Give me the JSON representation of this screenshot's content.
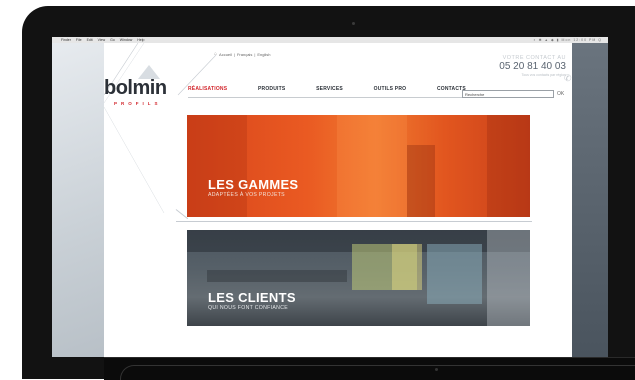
{
  "menubar": {
    "items": [
      "Finder",
      "File",
      "Edit",
      "View",
      "Go",
      "Window",
      "Help"
    ],
    "status": "◐ ✱ ▲ ◆ ▮ Mon 12:00 PM Q"
  },
  "site": {
    "logo_text": "bolmin",
    "logo_subtext": "PROFILS",
    "top_links": {
      "home": "Accueil",
      "sep1": "|",
      "lang_fr": "Français",
      "sep2": "|",
      "lang_en": "English"
    },
    "nav": [
      "RÉALISATIONS",
      "PRODUITS",
      "SERVICES",
      "OUTILS PRO",
      "CONTACTS"
    ],
    "contact": {
      "title": "VOTRE CONTACT AU",
      "phone": "05 20 81 40 03",
      "note": "Tous vos contacts par région"
    },
    "search": {
      "value": "Recherche",
      "button": "OK"
    },
    "banners": [
      {
        "title": "LES GAMMES",
        "subtitle": "ADAPTÉES À VOS PROJETS"
      },
      {
        "title": "LES CLIENTS",
        "subtitle": "QUI NOUS FONT CONFIANCE"
      }
    ]
  },
  "colors": {
    "brand_red": "#d2262c",
    "gammes_orange": "#e8541f",
    "dark_text": "#2c3138"
  }
}
